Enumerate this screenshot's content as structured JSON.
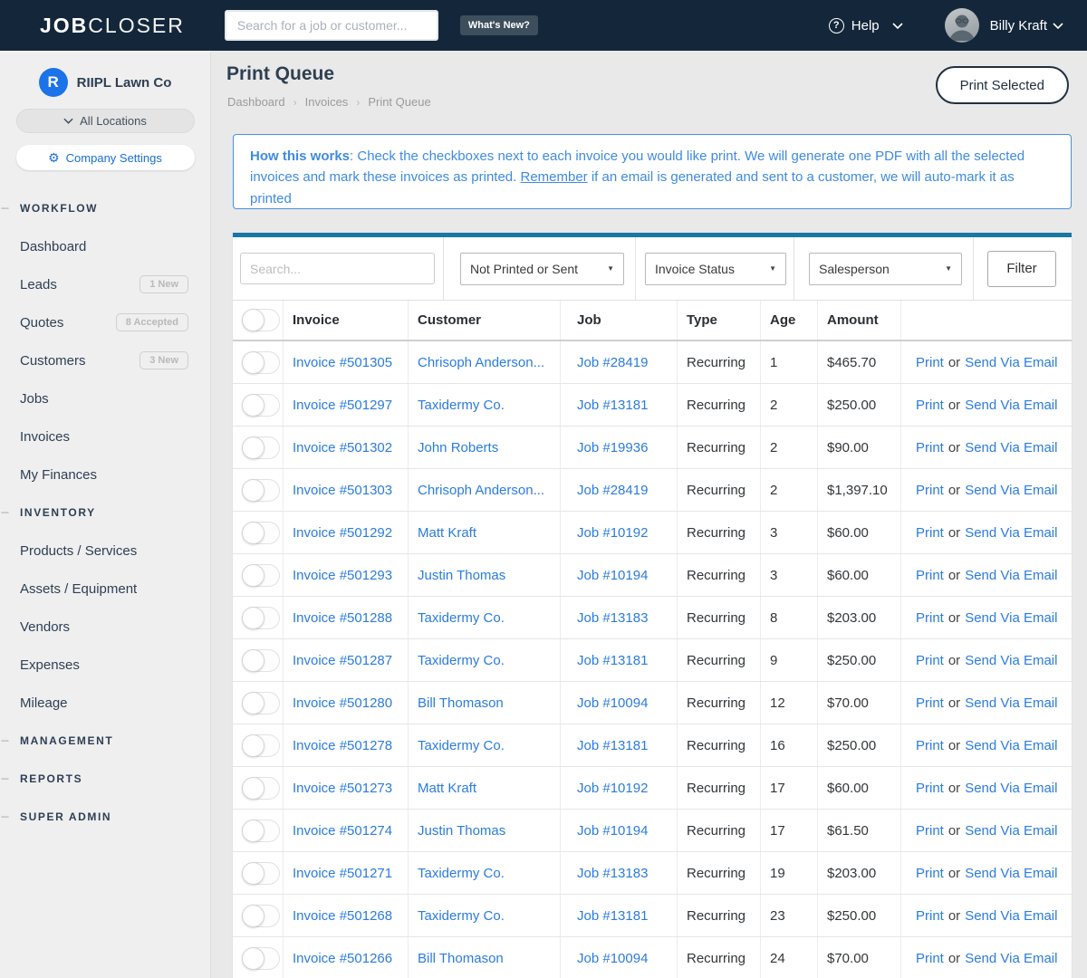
{
  "colors": {
    "navbar_bg": "#14273A",
    "accent_blue": "#2A7CDF",
    "info_blue": "#3E8BE0",
    "teal_bar": "#1878A3",
    "brand_blue": "#1A73E8"
  },
  "navbar": {
    "logo_bold": "JOB",
    "logo_light": "CLOSER",
    "search_placeholder": "Search for a job or customer...",
    "whats_new_label": "What's New?",
    "help_label": "Help",
    "user_name": "Billy Kraft"
  },
  "sidebar": {
    "company_initial": "R",
    "company_name": "RIIPL Lawn Co",
    "locations_label": "All Locations",
    "company_settings_label": "Company Settings",
    "sections": [
      {
        "header": "WORKFLOW",
        "items": [
          {
            "label": "Dashboard"
          },
          {
            "label": "Leads",
            "badge": "1 New"
          },
          {
            "label": "Quotes",
            "badge": "8 Accepted"
          },
          {
            "label": "Customers",
            "badge": "3 New"
          },
          {
            "label": "Jobs"
          },
          {
            "label": "Invoices"
          },
          {
            "label": "My Finances"
          }
        ]
      },
      {
        "header": "INVENTORY",
        "items": [
          {
            "label": "Products / Services"
          },
          {
            "label": "Assets / Equipment"
          },
          {
            "label": "Vendors"
          },
          {
            "label": "Expenses"
          },
          {
            "label": "Mileage"
          }
        ]
      },
      {
        "header": "MANAGEMENT",
        "items": []
      },
      {
        "header": "REPORTS",
        "items": []
      },
      {
        "header": "SUPER ADMIN",
        "items": []
      }
    ]
  },
  "main": {
    "title": "Print Queue",
    "breadcrumb": [
      "Dashboard",
      "Invoices",
      "Print Queue"
    ],
    "print_selected_label": "Print Selected",
    "info": {
      "bold": "How this works",
      "text1": ": Check the checkboxes next to each invoice you would like print. We will generate one PDF with all the selected invoices and mark these invoices as printed. ",
      "underline": "Remember",
      "text2": " if an email is generated and sent to a customer, we will auto-mark it as printed"
    },
    "filters": {
      "search_placeholder": "Search...",
      "printed_filter": "Not Printed or Sent",
      "status_filter": "Invoice Status",
      "salesperson_filter": "Salesperson",
      "filter_button": "Filter"
    },
    "table": {
      "headers": [
        "Invoice",
        "Customer",
        "Job",
        "Type",
        "Age",
        "Amount"
      ],
      "action_print": "Print",
      "action_or": "or",
      "action_email": "Send Via Email",
      "rows": [
        {
          "invoice": "Invoice #501305",
          "customer": "Chrisoph Anderson...",
          "job": "Job #28419",
          "type": "Recurring",
          "age": "1",
          "amount": "$465.70"
        },
        {
          "invoice": "Invoice #501297",
          "customer": "Taxidermy Co.",
          "job": "Job #13181",
          "type": "Recurring",
          "age": "2",
          "amount": "$250.00"
        },
        {
          "invoice": "Invoice #501302",
          "customer": "John Roberts",
          "job": "Job #19936",
          "type": "Recurring",
          "age": "2",
          "amount": "$90.00"
        },
        {
          "invoice": "Invoice #501303",
          "customer": "Chrisoph Anderson...",
          "job": "Job #28419",
          "type": "Recurring",
          "age": "2",
          "amount": "$1,397.10"
        },
        {
          "invoice": "Invoice #501292",
          "customer": "Matt Kraft",
          "job": "Job #10192",
          "type": "Recurring",
          "age": "3",
          "amount": "$60.00"
        },
        {
          "invoice": "Invoice #501293",
          "customer": "Justin Thomas",
          "job": "Job #10194",
          "type": "Recurring",
          "age": "3",
          "amount": "$60.00"
        },
        {
          "invoice": "Invoice #501288",
          "customer": "Taxidermy Co.",
          "job": "Job #13183",
          "type": "Recurring",
          "age": "8",
          "amount": "$203.00"
        },
        {
          "invoice": "Invoice #501287",
          "customer": "Taxidermy Co.",
          "job": "Job #13181",
          "type": "Recurring",
          "age": "9",
          "amount": "$250.00"
        },
        {
          "invoice": "Invoice #501280",
          "customer": "Bill Thomason",
          "job": "Job #10094",
          "type": "Recurring",
          "age": "12",
          "amount": "$70.00"
        },
        {
          "invoice": "Invoice #501278",
          "customer": "Taxidermy Co.",
          "job": "Job #13181",
          "type": "Recurring",
          "age": "16",
          "amount": "$250.00"
        },
        {
          "invoice": "Invoice #501273",
          "customer": "Matt Kraft",
          "job": "Job #10192",
          "type": "Recurring",
          "age": "17",
          "amount": "$60.00"
        },
        {
          "invoice": "Invoice #501274",
          "customer": "Justin Thomas",
          "job": "Job #10194",
          "type": "Recurring",
          "age": "17",
          "amount": "$61.50"
        },
        {
          "invoice": "Invoice #501271",
          "customer": "Taxidermy Co.",
          "job": "Job #13183",
          "type": "Recurring",
          "age": "19",
          "amount": "$203.00"
        },
        {
          "invoice": "Invoice #501268",
          "customer": "Taxidermy Co.",
          "job": "Job #13181",
          "type": "Recurring",
          "age": "23",
          "amount": "$250.00"
        },
        {
          "invoice": "Invoice #501266",
          "customer": "Bill Thomason",
          "job": "Job #10094",
          "type": "Recurring",
          "age": "24",
          "amount": "$70.00"
        }
      ]
    }
  }
}
